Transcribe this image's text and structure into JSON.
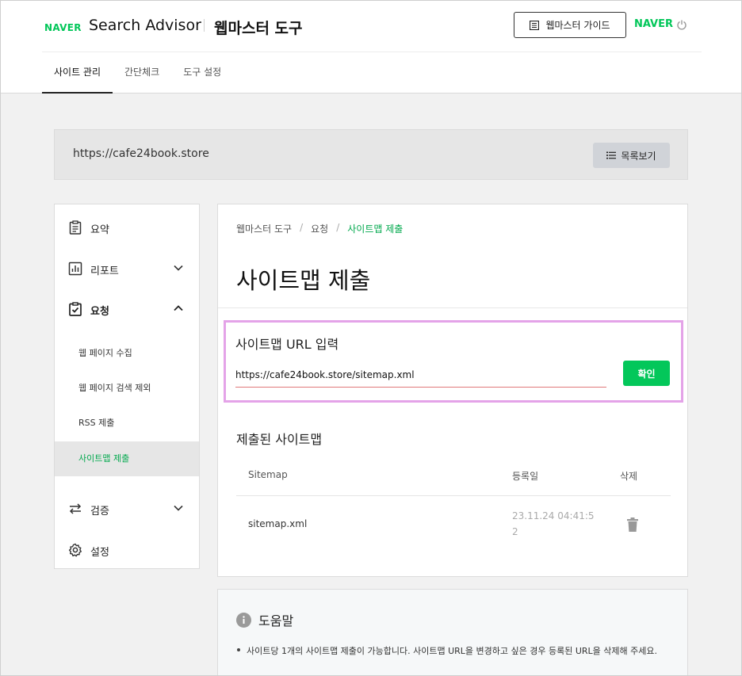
{
  "header": {
    "logo": "NAVER",
    "product_name": "Search Advisor",
    "tool_title": "웹마스터 도구",
    "guide_button": "웹마스터 가이드",
    "naver_link": "NAVER"
  },
  "nav": {
    "tabs": [
      {
        "label": "사이트 관리",
        "active": true
      },
      {
        "label": "간단체크",
        "active": false
      },
      {
        "label": "도구 설정",
        "active": false
      }
    ]
  },
  "site_bar": {
    "url": "https://cafe24book.store",
    "list_button": "목록보기"
  },
  "sidebar": {
    "items": [
      {
        "label": "요약",
        "icon": "clipboard-icon"
      },
      {
        "label": "리포트",
        "icon": "report-chart-icon"
      },
      {
        "label": "요청",
        "icon": "request-check-icon"
      },
      {
        "label": "검증",
        "icon": "verify-arrows-icon"
      },
      {
        "label": "설정",
        "icon": "gear-icon"
      }
    ],
    "sub_items": [
      {
        "label": "웹 페이지 수집"
      },
      {
        "label": "웹 페이지 검색 제외"
      },
      {
        "label": "RSS 제출"
      },
      {
        "label": "사이트맵 제출",
        "active": true
      }
    ]
  },
  "breadcrumb": [
    "웹마스터 도구",
    "요청",
    "사이트맵 제출"
  ],
  "page_title": "사이트맵 제출",
  "sitemap_input": {
    "label": "사이트맵 URL 입력",
    "value": "https://cafe24book.store/sitemap.xml",
    "button": "확인"
  },
  "submitted": {
    "title": "제출된 사이트맵",
    "columns": [
      "Sitemap",
      "등록일",
      "삭제"
    ],
    "rows": [
      {
        "sitemap": "sitemap.xml",
        "date": "23.11.24 04:41:52"
      }
    ]
  },
  "help": {
    "title": "도움말",
    "text": "사이트당 1개의 사이트맵 제출이 가능합니다. 사이트맵 URL을 변경하고 싶은 경우 등록된 URL을 삭제해 주세요."
  },
  "colors": {
    "accent": "#03c75a",
    "highlight_border": "#e4a3e8"
  }
}
